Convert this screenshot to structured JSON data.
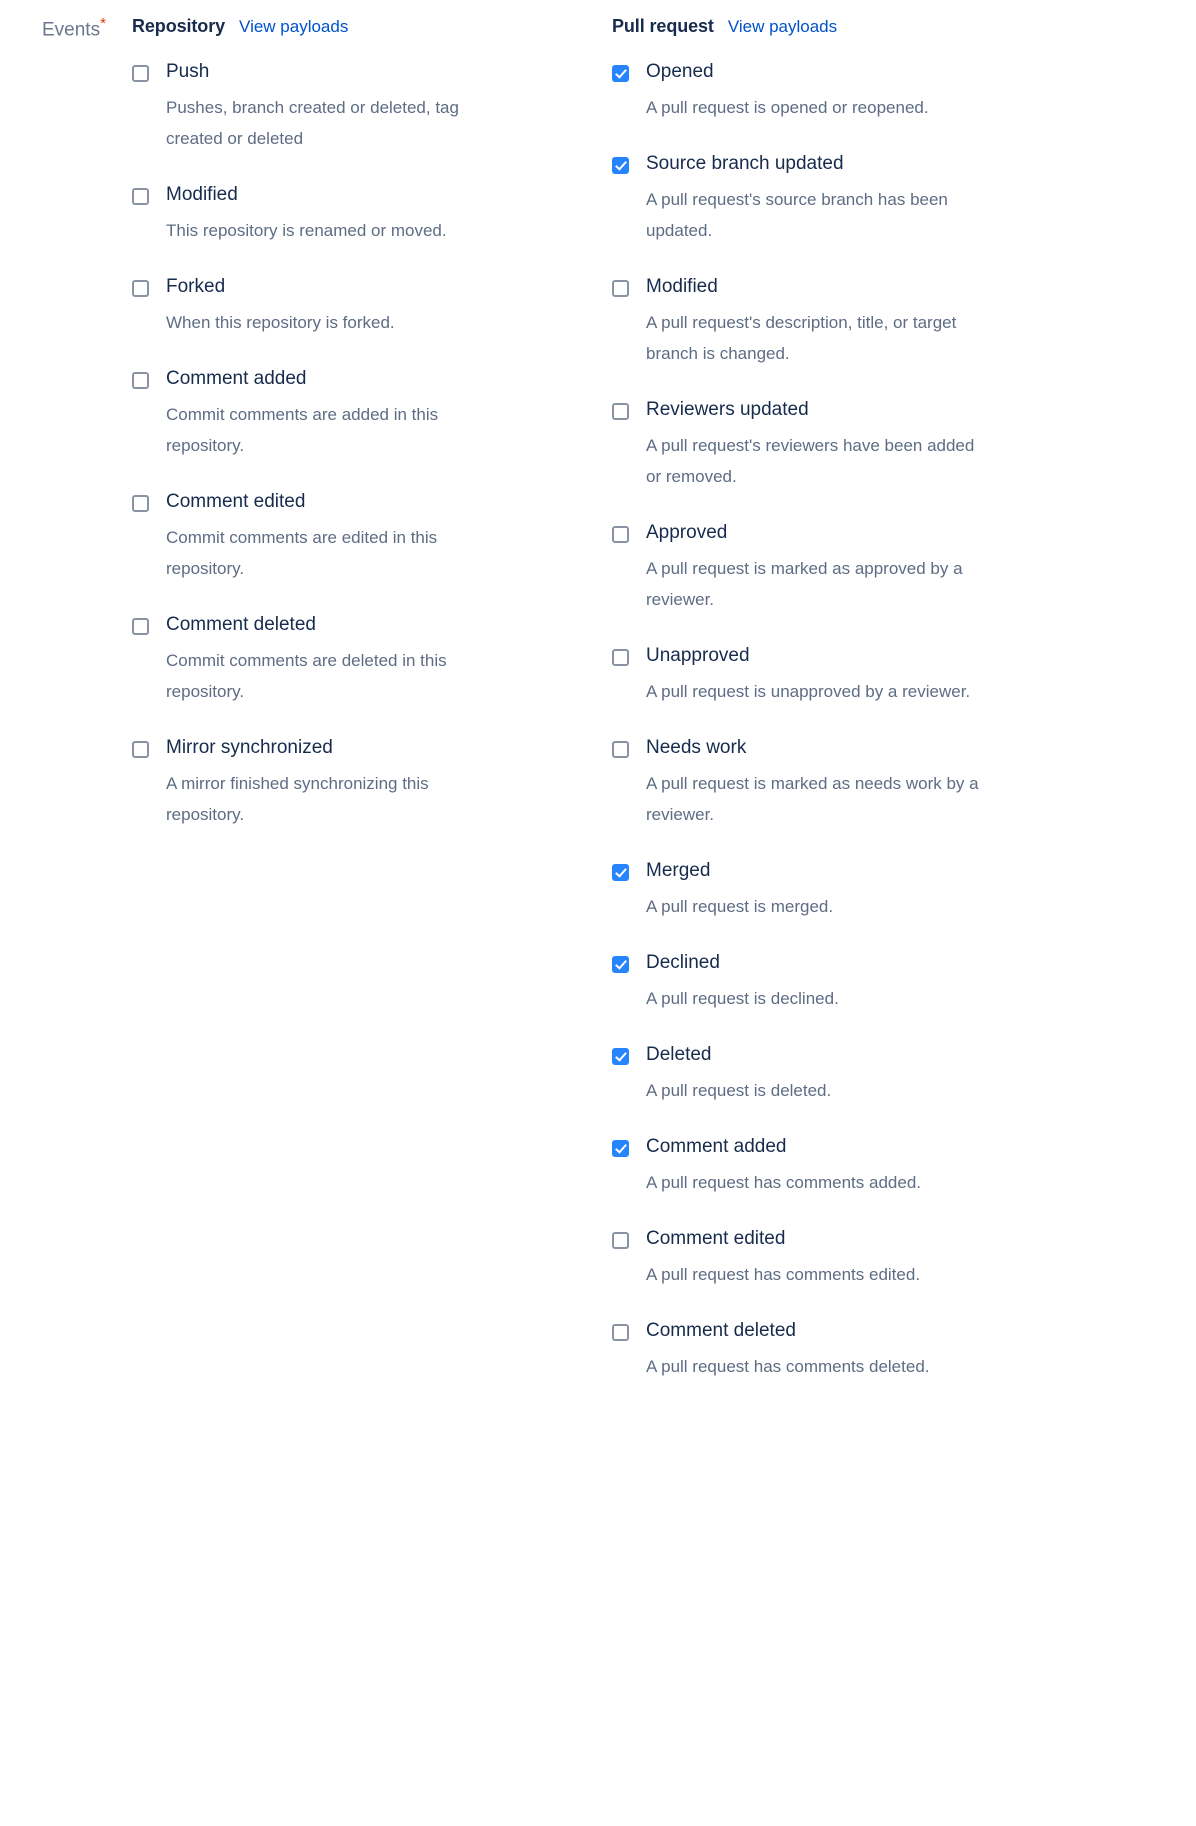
{
  "form": {
    "field_label": "Events",
    "required_marker": "*",
    "accent_link_color": "#0052CC",
    "checkbox_checked_color": "#2684FF",
    "required_marker_color": "#DE350B",
    "label_text_color": "#172B4D",
    "description_text_color": "#5E6C84"
  },
  "columns": [
    {
      "key": "repository",
      "title": "Repository",
      "view_payloads_label": "View payloads",
      "items": [
        {
          "label": "Push",
          "description": "Pushes, branch created or deleted, tag created or deleted",
          "checked": false
        },
        {
          "label": "Modified",
          "description": "This repository is renamed or moved.",
          "checked": false
        },
        {
          "label": "Forked",
          "description": "When this repository is forked.",
          "checked": false
        },
        {
          "label": "Comment added",
          "description": "Commit comments are added in this repository.",
          "checked": false
        },
        {
          "label": "Comment edited",
          "description": "Commit comments are edited in this repository.",
          "checked": false
        },
        {
          "label": "Comment deleted",
          "description": "Commit comments are deleted in this repository.",
          "checked": false
        },
        {
          "label": "Mirror synchronized",
          "description": "A mirror finished synchronizing this repository.",
          "checked": false
        }
      ]
    },
    {
      "key": "pull_request",
      "title": "Pull request",
      "view_payloads_label": "View payloads",
      "items": [
        {
          "label": "Opened",
          "description": "A pull request is opened or reopened.",
          "checked": true
        },
        {
          "label": "Source branch updated",
          "description": "A pull request's source branch has been updated.",
          "checked": true
        },
        {
          "label": "Modified",
          "description": "A pull request's description, title, or target branch is changed.",
          "checked": false
        },
        {
          "label": "Reviewers updated",
          "description": "A pull request's reviewers have been added or removed.",
          "checked": false
        },
        {
          "label": "Approved",
          "description": "A pull request is marked as approved by a reviewer.",
          "checked": false
        },
        {
          "label": "Unapproved",
          "description": "A pull request is unapproved by a reviewer.",
          "checked": false
        },
        {
          "label": "Needs work",
          "description": "A pull request is marked as needs work by a reviewer.",
          "checked": false
        },
        {
          "label": "Merged",
          "description": "A pull request is merged.",
          "checked": true
        },
        {
          "label": "Declined",
          "description": "A pull request is declined.",
          "checked": true
        },
        {
          "label": "Deleted",
          "description": "A pull request is deleted.",
          "checked": true
        },
        {
          "label": "Comment added",
          "description": "A pull request has comments added.",
          "checked": true
        },
        {
          "label": "Comment edited",
          "description": "A pull request has comments edited.",
          "checked": false
        },
        {
          "label": "Comment deleted",
          "description": "A pull request has comments deleted.",
          "checked": false
        }
      ]
    }
  ]
}
